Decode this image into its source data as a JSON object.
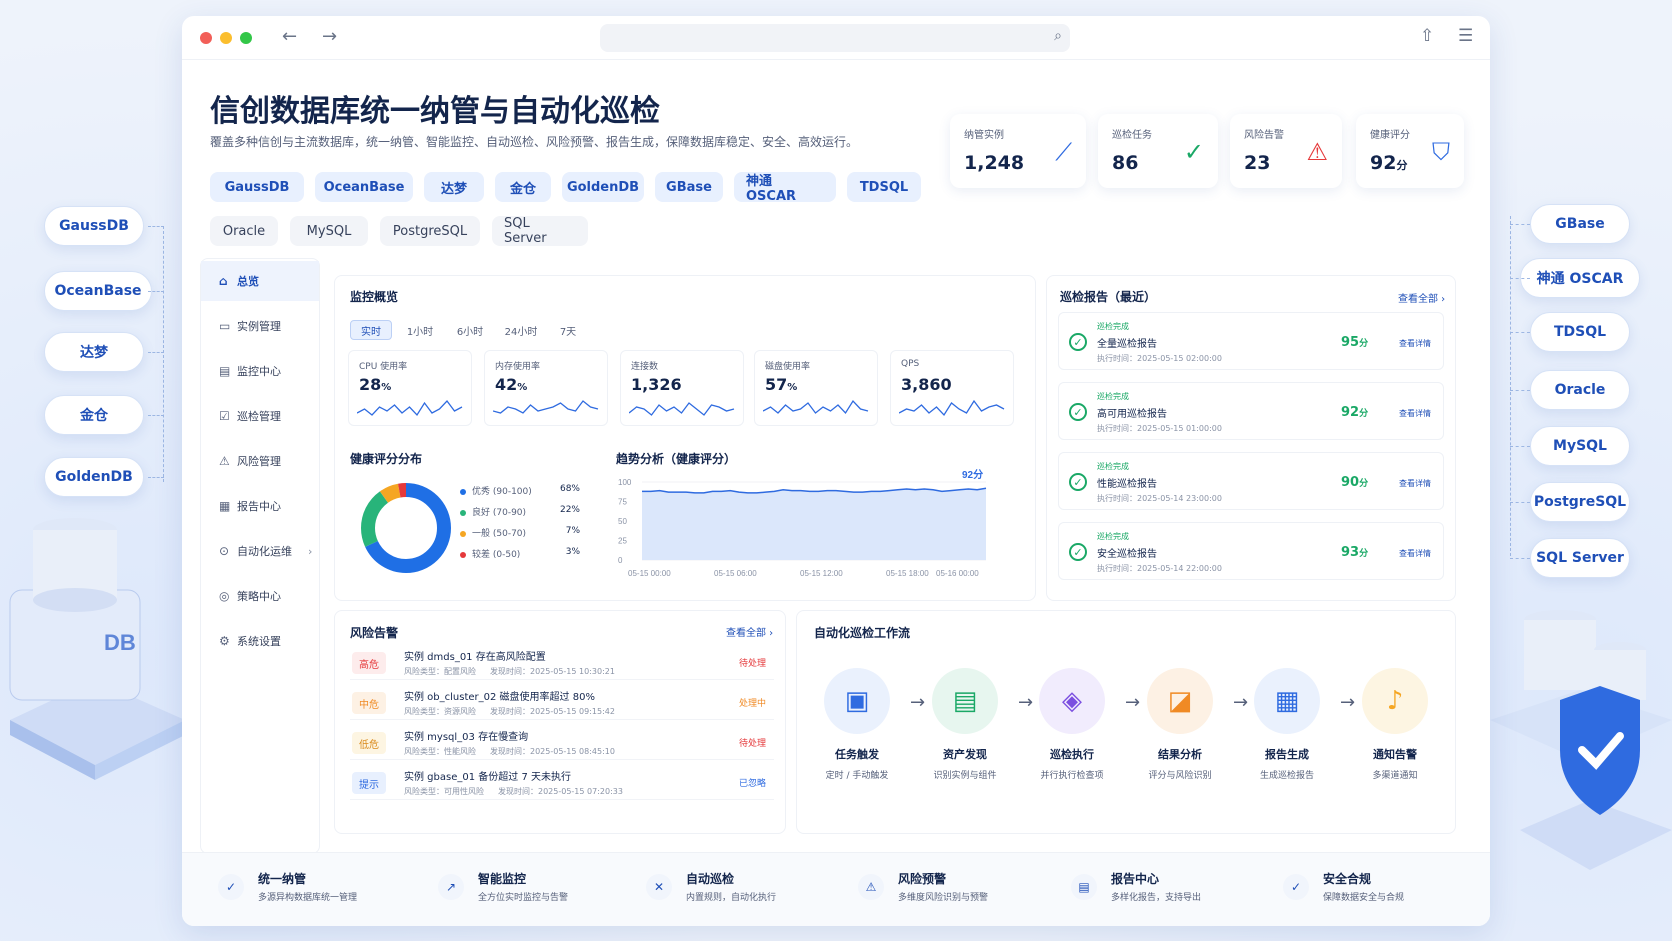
{
  "title": "信创数据库统一纳管与自动化巡检",
  "subtitle": "覆盖多种信创与主流数据库，统一纳管、智能监控、自动巡检、风险预警、报告生成，保障数据库稳定、安全、高效运行。",
  "db_tags_primary": [
    "GaussDB",
    "OceanBase",
    "达梦",
    "金仓",
    "GoldenDB",
    "GBase",
    "神通 OSCAR",
    "TDSQL"
  ],
  "db_tags_secondary": [
    "Oracle",
    "MySQL",
    "PostgreSQL",
    "SQL Server"
  ],
  "left_pills": [
    "GaussDB",
    "OceanBase",
    "达梦",
    "金仓",
    "GoldenDB"
  ],
  "right_pills": [
    "GBase",
    "神通 OSCAR",
    "TDSQL",
    "Oracle",
    "MySQL",
    "PostgreSQL",
    "SQL Server"
  ],
  "deco_db_label": "DB",
  "stats": [
    {
      "label": "纳管实例",
      "value": "1,248",
      "unit": "",
      "icon": "trend-icon",
      "color": "#2f6be0"
    },
    {
      "label": "巡检任务",
      "value": "86",
      "unit": "",
      "icon": "check-circle-icon",
      "color": "#1aa866"
    },
    {
      "label": "风险告警",
      "value": "23",
      "unit": "",
      "icon": "warning-icon",
      "color": "#e5393b"
    },
    {
      "label": "健康评分",
      "value": "92",
      "unit": "分",
      "icon": "shield-icon",
      "color": "#2f6be0"
    }
  ],
  "sidebar": [
    {
      "label": "总览",
      "icon": "home-icon",
      "glyph": "⌂"
    },
    {
      "label": "实例管理",
      "icon": "database-icon",
      "glyph": "▭"
    },
    {
      "label": "监控中心",
      "icon": "monitor-icon",
      "glyph": "▤"
    },
    {
      "label": "巡检管理",
      "icon": "checklist-icon",
      "glyph": "☑"
    },
    {
      "label": "风险管理",
      "icon": "warning-icon",
      "glyph": "⚠"
    },
    {
      "label": "报告中心",
      "icon": "report-icon",
      "glyph": "▦"
    },
    {
      "label": "自动化运维",
      "icon": "automation-icon",
      "glyph": "⊙",
      "chevron": "›"
    },
    {
      "label": "策略中心",
      "icon": "policy-icon",
      "glyph": "◎"
    },
    {
      "label": "系统设置",
      "icon": "gear-icon",
      "glyph": "⚙"
    }
  ],
  "monitor": {
    "title": "监控概览",
    "ranges": [
      "实时",
      "1小时",
      "6小时",
      "24小时",
      "7天"
    ],
    "metrics": [
      {
        "label": "CPU 使用率",
        "value": "28",
        "unit": "%"
      },
      {
        "label": "内存使用率",
        "value": "42",
        "unit": "%"
      },
      {
        "label": "连接数",
        "value": "1,326",
        "unit": ""
      },
      {
        "label": "磁盘使用率",
        "value": "57",
        "unit": "%"
      },
      {
        "label": "QPS",
        "value": "3,860",
        "unit": ""
      }
    ]
  },
  "health": {
    "title": "健康评分分布",
    "items": [
      {
        "label": "优秀 (90-100)",
        "value": "68%",
        "pct": 68,
        "color": "#1f6fe5"
      },
      {
        "label": "良好 (70-90)",
        "value": "22%",
        "pct": 22,
        "color": "#28b47a"
      },
      {
        "label": "一般 (50-70)",
        "value": "7%",
        "pct": 7,
        "color": "#f5a623"
      },
      {
        "label": "较差 (0-50)",
        "value": "3%",
        "pct": 3,
        "color": "#e5393b"
      }
    ]
  },
  "chart_data": {
    "type": "area",
    "title": "趋势分析（健康评分）",
    "x_ticks": [
      "05-15 00:00",
      "05-15 06:00",
      "05-15 12:00",
      "05-15 18:00",
      "05-16 00:00"
    ],
    "y_ticks": [
      "100",
      "75",
      "50",
      "25",
      "0"
    ],
    "ylim": [
      0,
      100
    ],
    "end_label": "92分",
    "series": [
      {
        "values": [
          88,
          88,
          89,
          87,
          87,
          87,
          86,
          86,
          88,
          88,
          89,
          87,
          86,
          86,
          87,
          88,
          90,
          89,
          89,
          88,
          88,
          89,
          89,
          88,
          87,
          87,
          88,
          88,
          89,
          90,
          91,
          90,
          91,
          90,
          88,
          89,
          90,
          91,
          90,
          92
        ]
      }
    ]
  },
  "reports": {
    "title": "巡检报告（最近）",
    "view_all": "查看全部 ›",
    "items": [
      {
        "status": "巡检完成",
        "name": "全量巡检报告",
        "time": "执行时间：2025-05-15 02:00:00",
        "score": "95",
        "unit": "分",
        "detail": "查看详情"
      },
      {
        "status": "巡检完成",
        "name": "高可用巡检报告",
        "time": "执行时间：2025-05-15 01:00:00",
        "score": "92",
        "unit": "分",
        "detail": "查看详情"
      },
      {
        "status": "巡检完成",
        "name": "性能巡检报告",
        "time": "执行时间：2025-05-14 23:00:00",
        "score": "90",
        "unit": "分",
        "detail": "查看详情"
      },
      {
        "status": "巡检完成",
        "name": "安全巡检报告",
        "time": "执行时间：2025-05-14 22:00:00",
        "score": "93",
        "unit": "分",
        "detail": "查看详情"
      }
    ]
  },
  "risks": {
    "title": "风险告警",
    "view_all": "查看全部 ›",
    "items": [
      {
        "level": "高危",
        "title": "实例 dmds_01 存在高风险配置",
        "type": "风险类型：配置风险",
        "time": "发现时间：2025-05-15 10:30:21",
        "status": "待处理",
        "color": "#e5393b",
        "bg": "#fdecec",
        "scolor": "#e5393b"
      },
      {
        "level": "中危",
        "title": "实例 ob_cluster_02 磁盘使用率超过 80%",
        "type": "风险类型：资源风险",
        "time": "发现时间：2025-05-15 09:15:42",
        "status": "处理中",
        "color": "#f08a24",
        "bg": "#fdf1e4",
        "scolor": "#f08a24"
      },
      {
        "level": "低危",
        "title": "实例 mysql_03 存在慢查询",
        "type": "风险类型：性能风险",
        "time": "发现时间：2025-05-15 08:45:10",
        "status": "待处理",
        "color": "#d9891a",
        "bg": "#fdf5e2",
        "scolor": "#e5393b"
      },
      {
        "level": "提示",
        "title": "实例 gbase_01 备份超过 7 天未执行",
        "type": "风险类型：可用性风险",
        "time": "发现时间：2025-05-15 07:20:33",
        "status": "已忽略",
        "color": "#2f6be0",
        "bg": "#e8f0fe",
        "scolor": "#2f6be0"
      }
    ]
  },
  "workflow": {
    "title": "自动化巡检工作流",
    "steps": [
      {
        "name": "任务触发",
        "desc": "定时 / 手动触发",
        "icon": "calendar-check-icon",
        "glyph": "▣",
        "color": "#2f6be0",
        "bg": "#eaf1fd"
      },
      {
        "name": "资产发现",
        "desc": "识别实例与组件",
        "icon": "clipboard-search-icon",
        "glyph": "▤",
        "color": "#1aa866",
        "bg": "#e7f6ef"
      },
      {
        "name": "巡检执行",
        "desc": "并行执行检查项",
        "icon": "shield-check-icon",
        "glyph": "◈",
        "color": "#7b4fe0",
        "bg": "#f1ecfd"
      },
      {
        "name": "结果分析",
        "desc": "评分与风险识别",
        "icon": "chart-analysis-icon",
        "glyph": "◪",
        "color": "#f08a24",
        "bg": "#fdf1e4"
      },
      {
        "name": "报告生成",
        "desc": "生成巡检报告",
        "icon": "document-icon",
        "glyph": "▦",
        "color": "#2f6be0",
        "bg": "#eaf1fd"
      },
      {
        "name": "通知告警",
        "desc": "多渠道通知",
        "icon": "bell-icon",
        "glyph": "♪",
        "color": "#f5a623",
        "bg": "#fdf5e2"
      }
    ]
  },
  "features": [
    {
      "title": "统一纳管",
      "desc": "多源异构数据库统一管理",
      "icon": "check-icon",
      "glyph": "✓"
    },
    {
      "title": "智能监控",
      "desc": "全方位实时监控与告警",
      "icon": "chart-icon",
      "glyph": "↗"
    },
    {
      "title": "自动巡检",
      "desc": "内置规则，自动化执行",
      "icon": "tools-icon",
      "glyph": "✕"
    },
    {
      "title": "风险预警",
      "desc": "多维度风险识别与预警",
      "icon": "warning-icon",
      "glyph": "⚠"
    },
    {
      "title": "报告中心",
      "desc": "多样化报告，支持导出",
      "icon": "report-icon",
      "glyph": "▤"
    },
    {
      "title": "安全合规",
      "desc": "保障数据安全与合规",
      "icon": "shield-icon",
      "glyph": "✓"
    }
  ]
}
